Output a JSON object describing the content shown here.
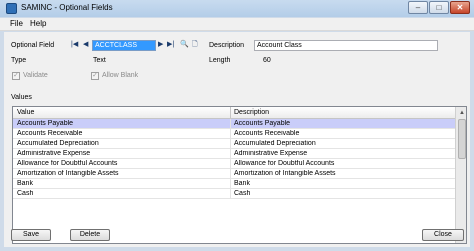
{
  "window": {
    "title": "SAMINC - Optional Fields",
    "icon": "app-icon",
    "controls": {
      "minimize": "–",
      "maximize": "□",
      "close": "✕"
    }
  },
  "menu": {
    "items": [
      {
        "label": "File"
      },
      {
        "label": "Help"
      }
    ]
  },
  "form": {
    "optional_field_label": "Optional Field",
    "optional_field_value": "ACCTCLASS",
    "nav_icons": [
      "first-icon",
      "previous-icon",
      "next-icon",
      "last-icon",
      "finder-icon",
      "new-document-icon"
    ],
    "description_label": "Description",
    "description_value": "Account Class",
    "type_label": "Type",
    "type_value": "Text",
    "length_label": "Length",
    "length_value": "60",
    "validate_label": "Validate",
    "validate_checked": true,
    "allow_blank_label": "Allow Blank",
    "allow_blank_checked": true,
    "values_label": "Values"
  },
  "table": {
    "columns": [
      "Value",
      "Description"
    ],
    "selected_index": 0,
    "rows": [
      {
        "value": "Accounts Payable",
        "description": "Accounts Payable"
      },
      {
        "value": "Accounts Receivable",
        "description": "Accounts Receivable"
      },
      {
        "value": "Accumulated Depreciation",
        "description": "Accumulated Depreciation"
      },
      {
        "value": "Administrative Expense",
        "description": "Administrative Expense"
      },
      {
        "value": "Allowance for Doubtful Accounts",
        "description": "Allowance for Doubtful Accounts"
      },
      {
        "value": "Amortization of Intangible Assets",
        "description": "Amortization of Intangible Assets"
      },
      {
        "value": "Bank",
        "description": "Bank"
      },
      {
        "value": "Cash",
        "description": "Cash"
      }
    ]
  },
  "buttons": {
    "save": "Save",
    "delete": "Delete",
    "close": "Close"
  },
  "colors": {
    "selection": "#3399ff",
    "row_selected": "#c9cdf9",
    "frame": "#cfdbe9"
  }
}
